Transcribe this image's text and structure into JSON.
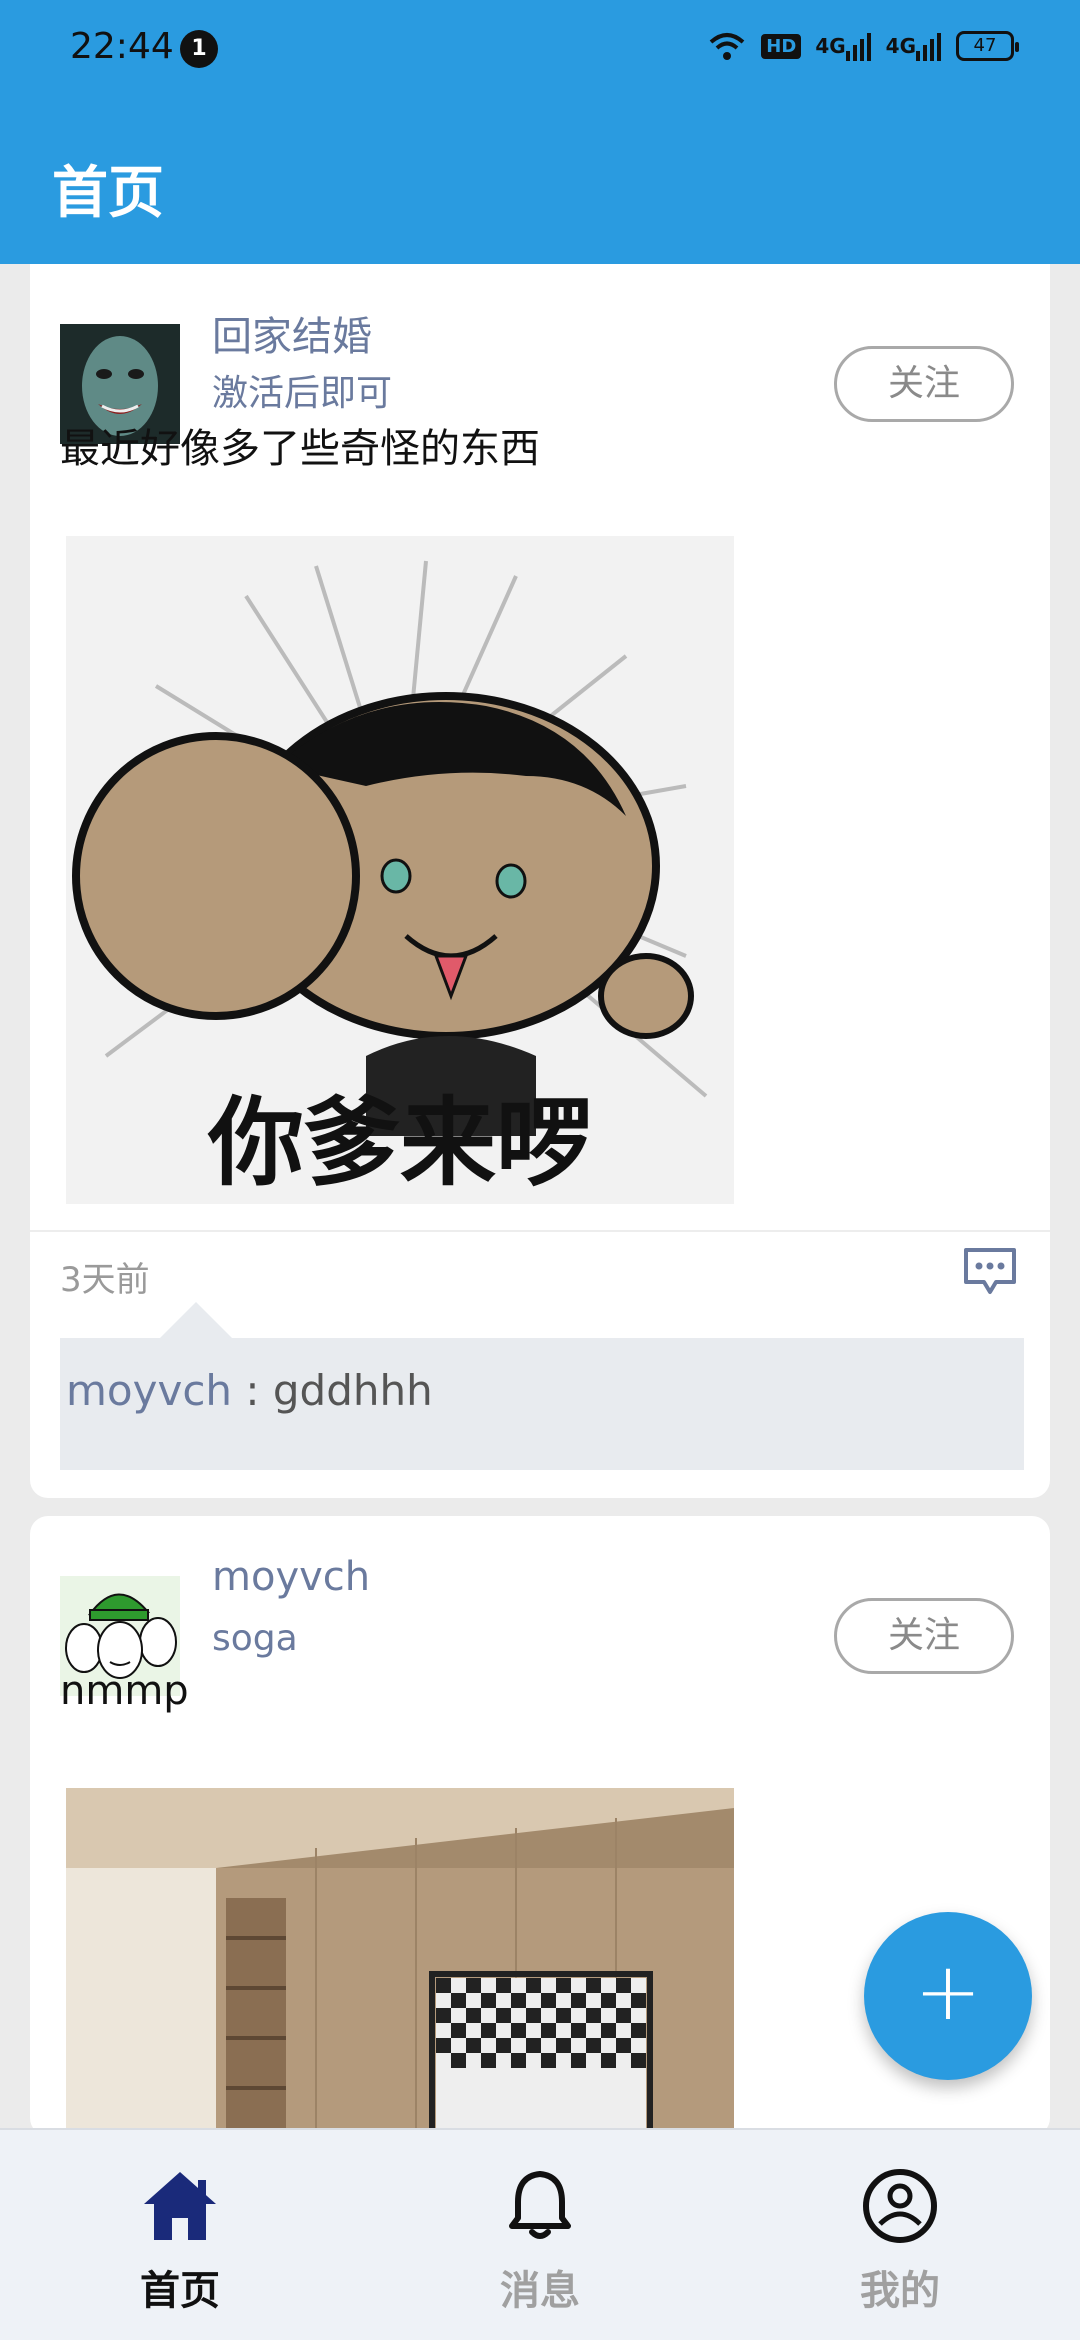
{
  "status_bar": {
    "time": "22:44",
    "notification_count": "1",
    "hd_label": "HD",
    "signal1_label": "4G",
    "signal2_label": "4G",
    "battery": "47"
  },
  "header": {
    "title": "首页"
  },
  "posts": [
    {
      "user_name": "回家结婚",
      "user_sub": "激活后即可",
      "follow_label": "关注",
      "content": "最近好像多了些奇怪的东西",
      "image_caption": "你爹来啰",
      "time_ago": "3天前",
      "comment_user": "moyvch",
      "comment_sep": " : ",
      "comment_text": "gddhhh"
    },
    {
      "user_name": "moyvch",
      "user_sub": "soga",
      "follow_label": "关注",
      "content": "nmmp"
    }
  ],
  "fab": {
    "label": "+"
  },
  "bottom_nav": [
    {
      "label": "首页",
      "icon": "home-icon",
      "active": true
    },
    {
      "label": "消息",
      "icon": "bell-icon",
      "active": false
    },
    {
      "label": "我的",
      "icon": "profile-icon",
      "active": false
    }
  ],
  "colors": {
    "primary": "#2a9be0",
    "username": "#6a7a9e",
    "nav_active": "#111111",
    "nav_inactive": "#a0a0a0",
    "home_icon": "#1a2a7a"
  }
}
